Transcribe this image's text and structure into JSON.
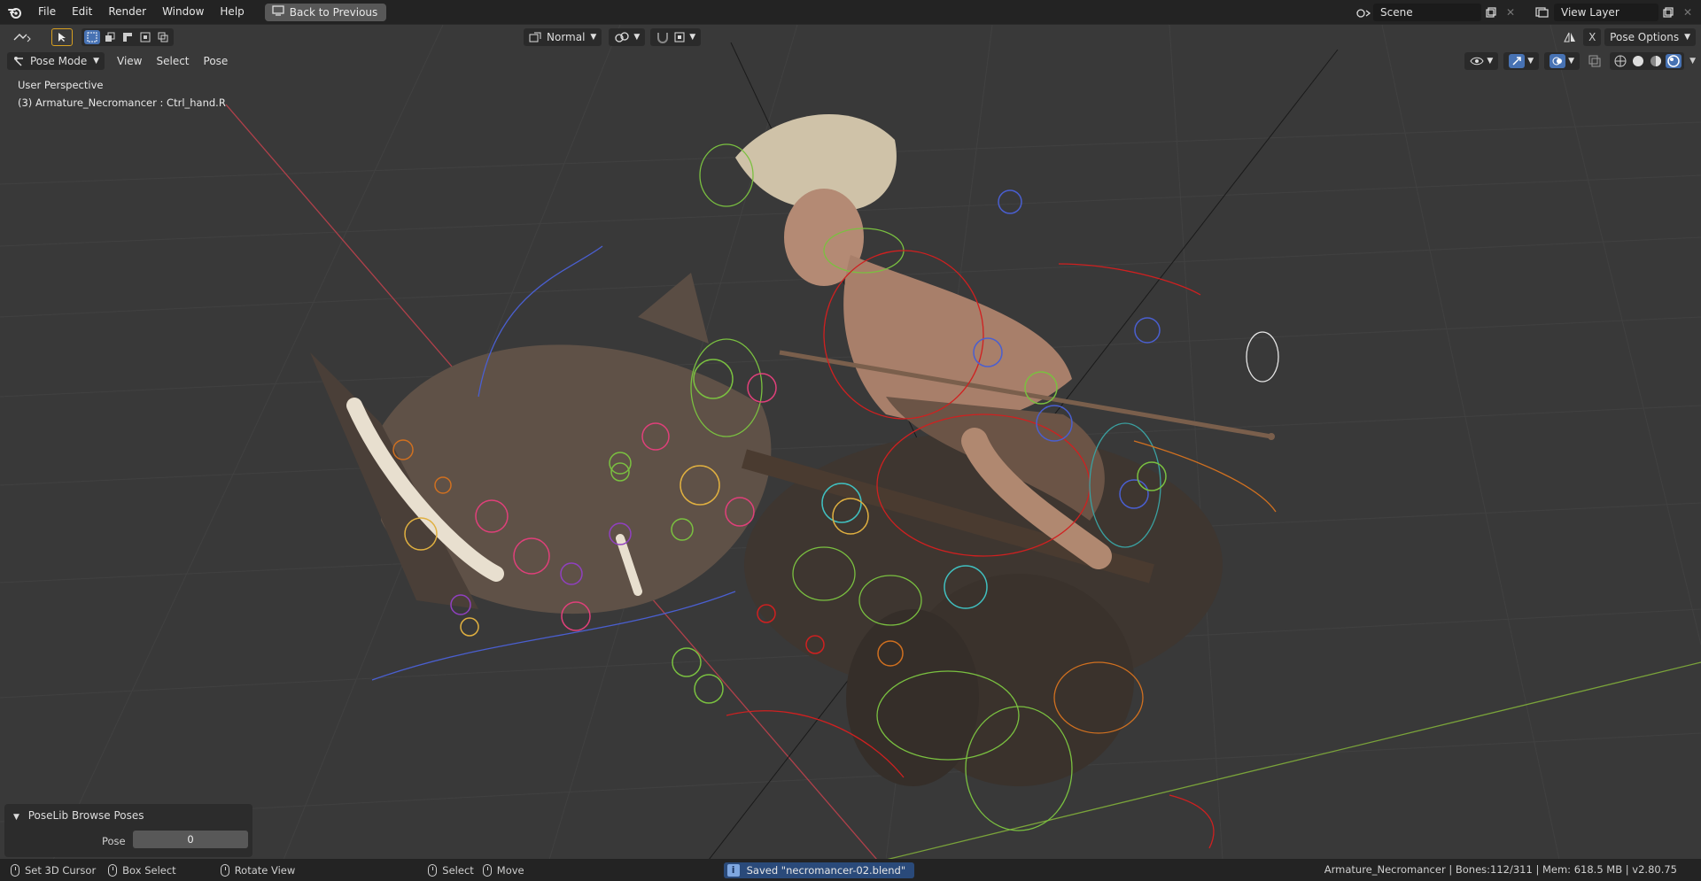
{
  "menu": {
    "items": [
      "File",
      "Edit",
      "Render",
      "Window",
      "Help"
    ],
    "back_button": "Back to Previous"
  },
  "topright": {
    "scene": "Scene",
    "view_layer": "View Layer"
  },
  "viewport_header": {
    "orientation": "Normal",
    "pose_options": "Pose Options",
    "mode": "Pose Mode",
    "menus": [
      "View",
      "Select",
      "Pose"
    ]
  },
  "overlay": {
    "perspective": "User Perspective",
    "object": "(3) Armature_Necromancer : Ctrl_hand.R"
  },
  "last_operator": {
    "title": "PoseLib Browse Poses",
    "field_label": "Pose",
    "field_value": "0"
  },
  "statusbar": {
    "set_cursor": "Set 3D Cursor",
    "box_select": "Box Select",
    "rotate_view": "Rotate View",
    "select": "Select",
    "move": "Move",
    "saved_message": "Saved \"necromancer-02.blend\"",
    "stats": "Armature_Necromancer | Bones:112/311  |  Mem: 618.5 MB | v2.80.75"
  },
  "colors": {
    "accent": "#4772b3",
    "viewport_bg": "#393939",
    "bar_bg": "#232323"
  }
}
